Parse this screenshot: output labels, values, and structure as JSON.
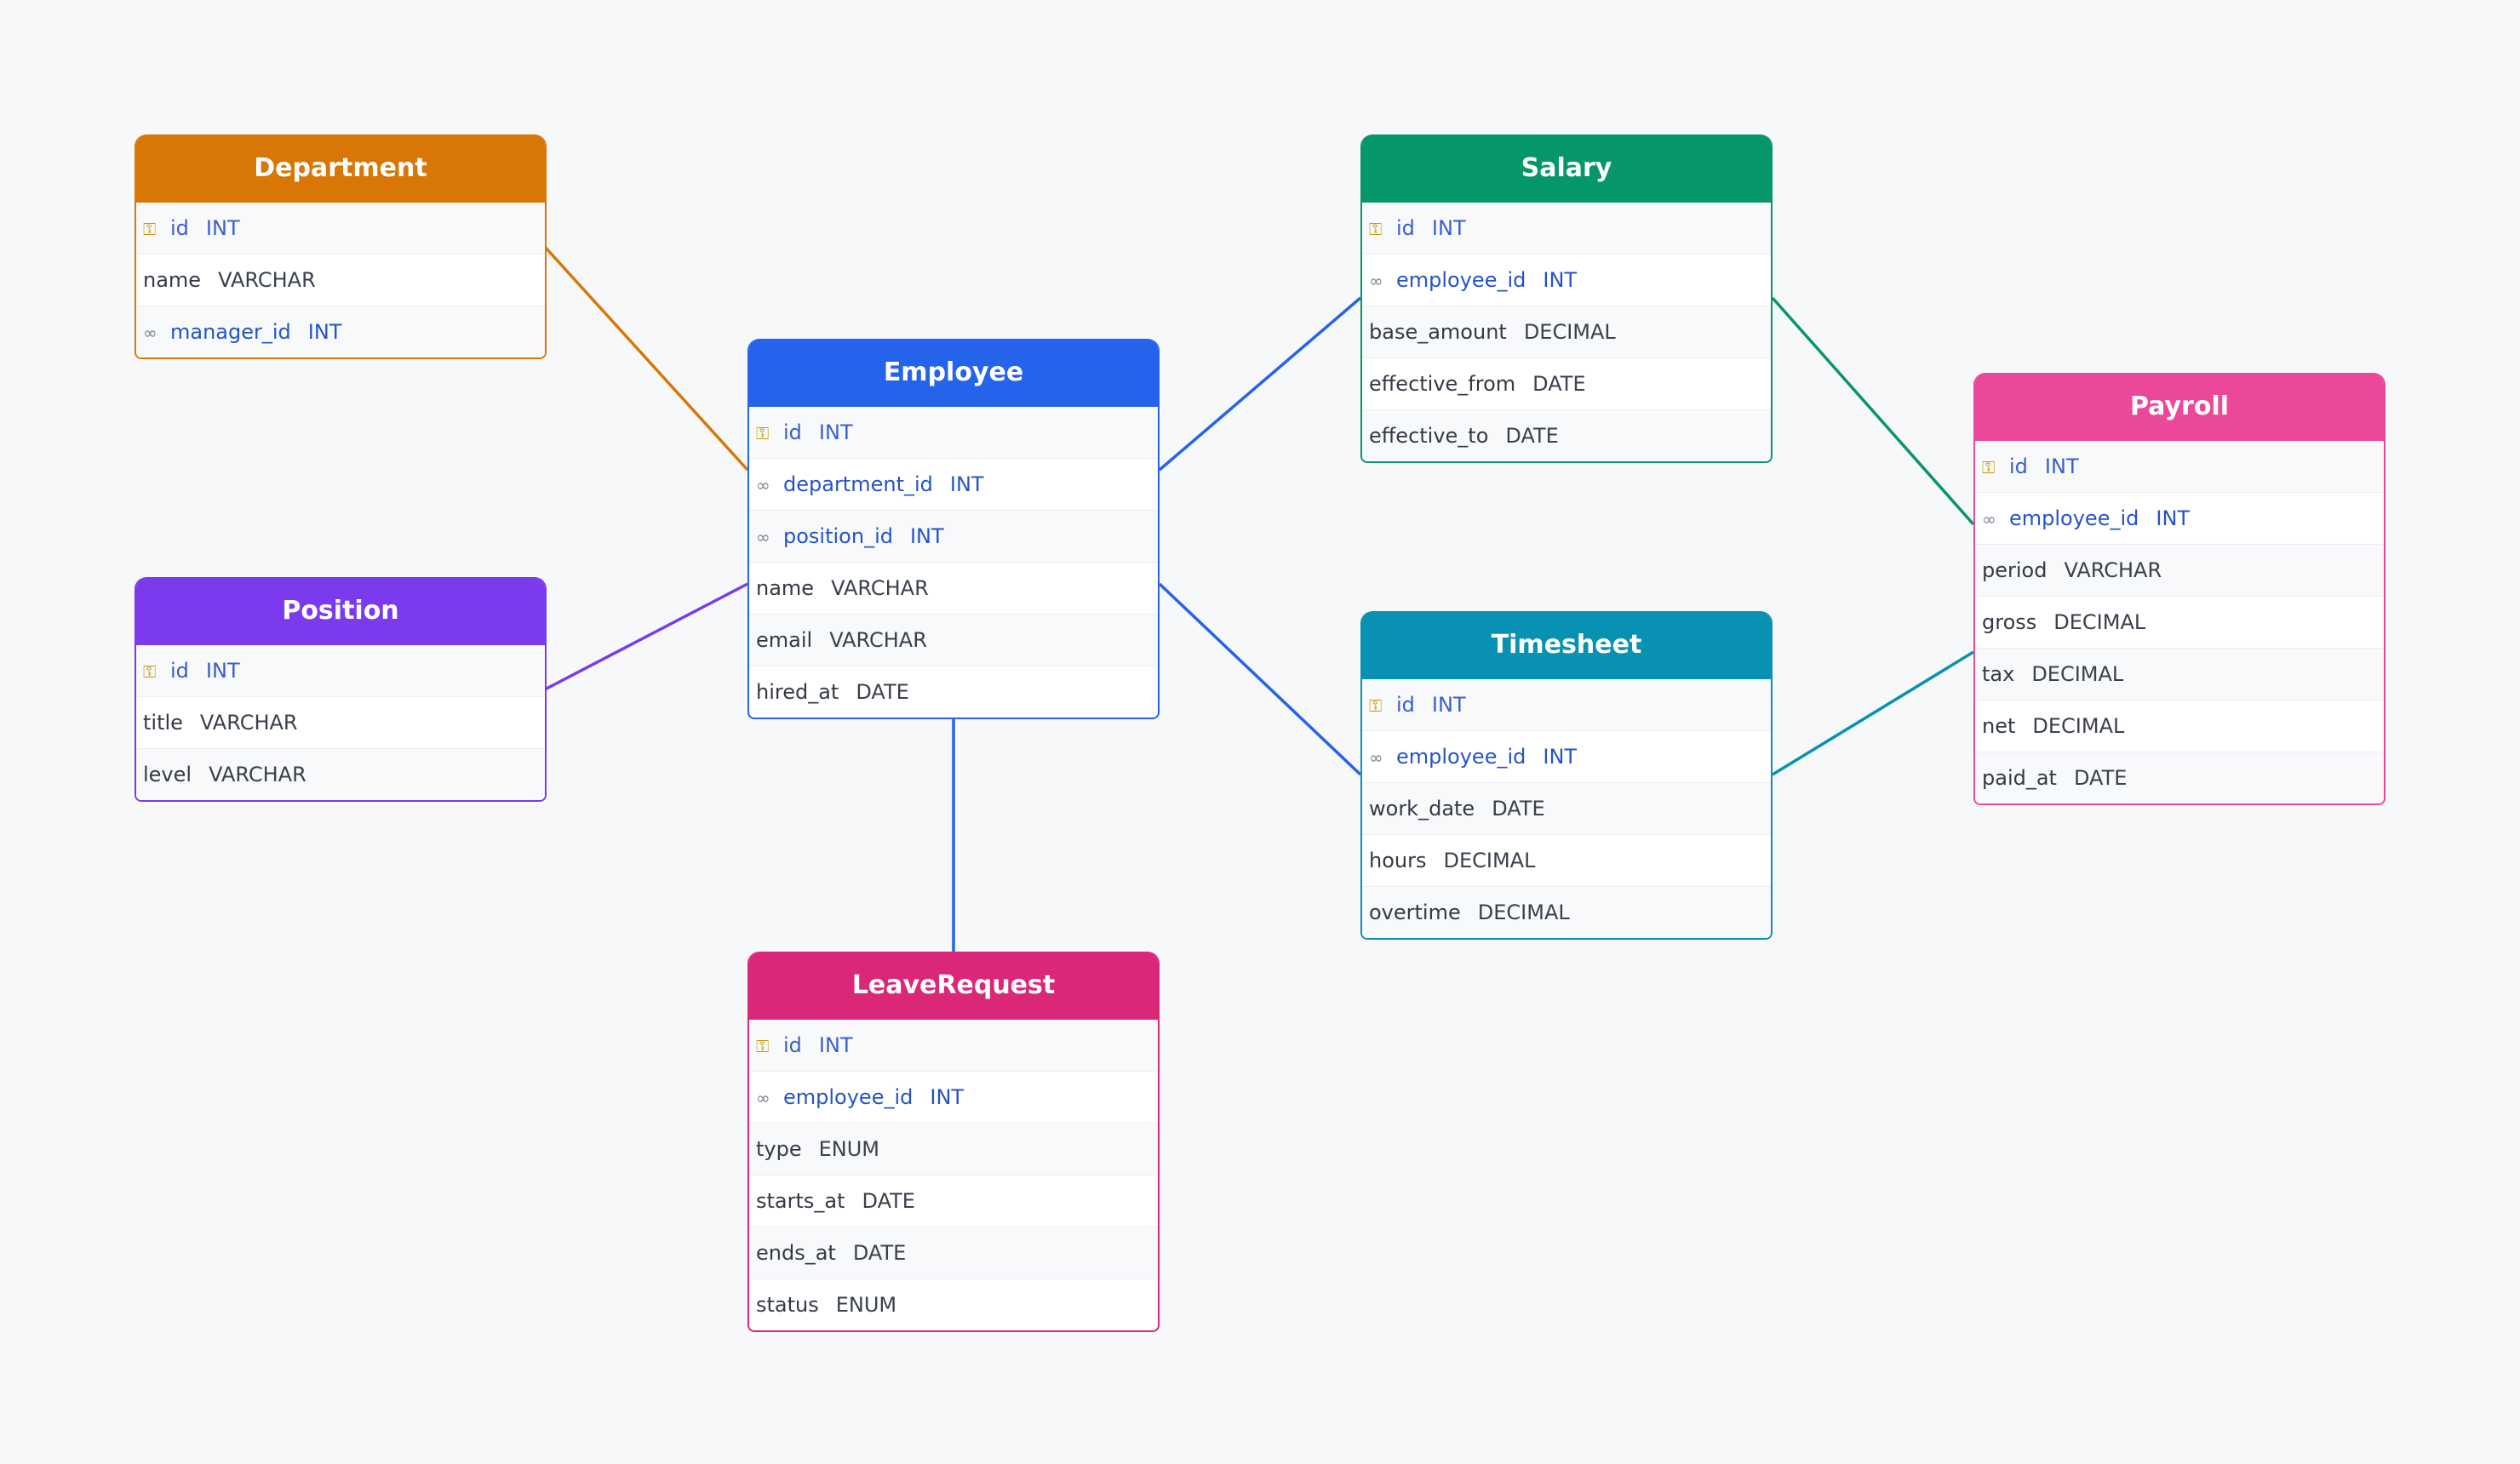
{
  "entities": {
    "department": {
      "name": "Department",
      "color": "#d97706",
      "fields": [
        {
          "icon": "key-icon",
          "name": "id",
          "type": "INT",
          "kind": "pk"
        },
        {
          "icon": "",
          "name": "name",
          "type": "VARCHAR",
          "kind": "plain"
        },
        {
          "icon": "link-icon",
          "name": "manager_id",
          "type": "INT",
          "kind": "fk"
        }
      ]
    },
    "position": {
      "name": "Position",
      "color": "#7c3aed",
      "fields": [
        {
          "icon": "key-icon",
          "name": "id",
          "type": "INT",
          "kind": "pk"
        },
        {
          "icon": "",
          "name": "title",
          "type": "VARCHAR",
          "kind": "plain"
        },
        {
          "icon": "",
          "name": "level",
          "type": "VARCHAR",
          "kind": "plain"
        }
      ]
    },
    "employee": {
      "name": "Employee",
      "color": "#2563eb",
      "fields": [
        {
          "icon": "key-icon",
          "name": "id",
          "type": "INT",
          "kind": "pk"
        },
        {
          "icon": "link-icon",
          "name": "department_id",
          "type": "INT",
          "kind": "fk"
        },
        {
          "icon": "link-icon",
          "name": "position_id",
          "type": "INT",
          "kind": "fk"
        },
        {
          "icon": "",
          "name": "name",
          "type": "VARCHAR",
          "kind": "plain"
        },
        {
          "icon": "",
          "name": "email",
          "type": "VARCHAR",
          "kind": "plain"
        },
        {
          "icon": "",
          "name": "hired_at",
          "type": "DATE",
          "kind": "plain"
        }
      ]
    },
    "leave_request": {
      "name": "LeaveRequest",
      "color": "#db2777",
      "fields": [
        {
          "icon": "key-icon",
          "name": "id",
          "type": "INT",
          "kind": "pk"
        },
        {
          "icon": "link-icon",
          "name": "employee_id",
          "type": "INT",
          "kind": "fk"
        },
        {
          "icon": "",
          "name": "type",
          "type": "ENUM",
          "kind": "plain"
        },
        {
          "icon": "",
          "name": "starts_at",
          "type": "DATE",
          "kind": "plain"
        },
        {
          "icon": "",
          "name": "ends_at",
          "type": "DATE",
          "kind": "plain"
        },
        {
          "icon": "",
          "name": "status",
          "type": "ENUM",
          "kind": "plain"
        }
      ]
    },
    "salary": {
      "name": "Salary",
      "color": "#059669",
      "fields": [
        {
          "icon": "key-icon",
          "name": "id",
          "type": "INT",
          "kind": "pk"
        },
        {
          "icon": "link-icon",
          "name": "employee_id",
          "type": "INT",
          "kind": "fk"
        },
        {
          "icon": "",
          "name": "base_amount",
          "type": "DECIMAL",
          "kind": "plain"
        },
        {
          "icon": "",
          "name": "effective_from",
          "type": "DATE",
          "kind": "plain"
        },
        {
          "icon": "",
          "name": "effective_to",
          "type": "DATE",
          "kind": "plain"
        }
      ]
    },
    "timesheet": {
      "name": "Timesheet",
      "color": "#0891b2",
      "fields": [
        {
          "icon": "key-icon",
          "name": "id",
          "type": "INT",
          "kind": "pk"
        },
        {
          "icon": "link-icon",
          "name": "employee_id",
          "type": "INT",
          "kind": "fk"
        },
        {
          "icon": "",
          "name": "work_date",
          "type": "DATE",
          "kind": "plain"
        },
        {
          "icon": "",
          "name": "hours",
          "type": "DECIMAL",
          "kind": "plain"
        },
        {
          "icon": "",
          "name": "overtime",
          "type": "DECIMAL",
          "kind": "plain"
        }
      ]
    },
    "payroll": {
      "name": "Payroll",
      "color": "#ec4899",
      "fields": [
        {
          "icon": "key-icon",
          "name": "id",
          "type": "INT",
          "kind": "pk"
        },
        {
          "icon": "link-icon",
          "name": "employee_id",
          "type": "INT",
          "kind": "fk"
        },
        {
          "icon": "",
          "name": "period",
          "type": "VARCHAR",
          "kind": "plain"
        },
        {
          "icon": "",
          "name": "gross",
          "type": "DECIMAL",
          "kind": "plain"
        },
        {
          "icon": "",
          "name": "tax",
          "type": "DECIMAL",
          "kind": "plain"
        },
        {
          "icon": "",
          "name": "net",
          "type": "DECIMAL",
          "kind": "plain"
        },
        {
          "icon": "",
          "name": "paid_at",
          "type": "DATE",
          "kind": "plain"
        }
      ]
    }
  },
  "relationships": [
    {
      "from": "department",
      "to": "employee",
      "color": "#d97706"
    },
    {
      "from": "position",
      "to": "employee",
      "color": "#7c3aed"
    },
    {
      "from": "employee",
      "to": "salary",
      "color": "#2563eb"
    },
    {
      "from": "employee",
      "to": "timesheet",
      "color": "#2563eb"
    },
    {
      "from": "employee",
      "to": "leave_request",
      "color": "#2563eb"
    },
    {
      "from": "salary",
      "to": "payroll",
      "color": "#059669"
    },
    {
      "from": "timesheet",
      "to": "payroll",
      "color": "#0891b2"
    }
  ]
}
